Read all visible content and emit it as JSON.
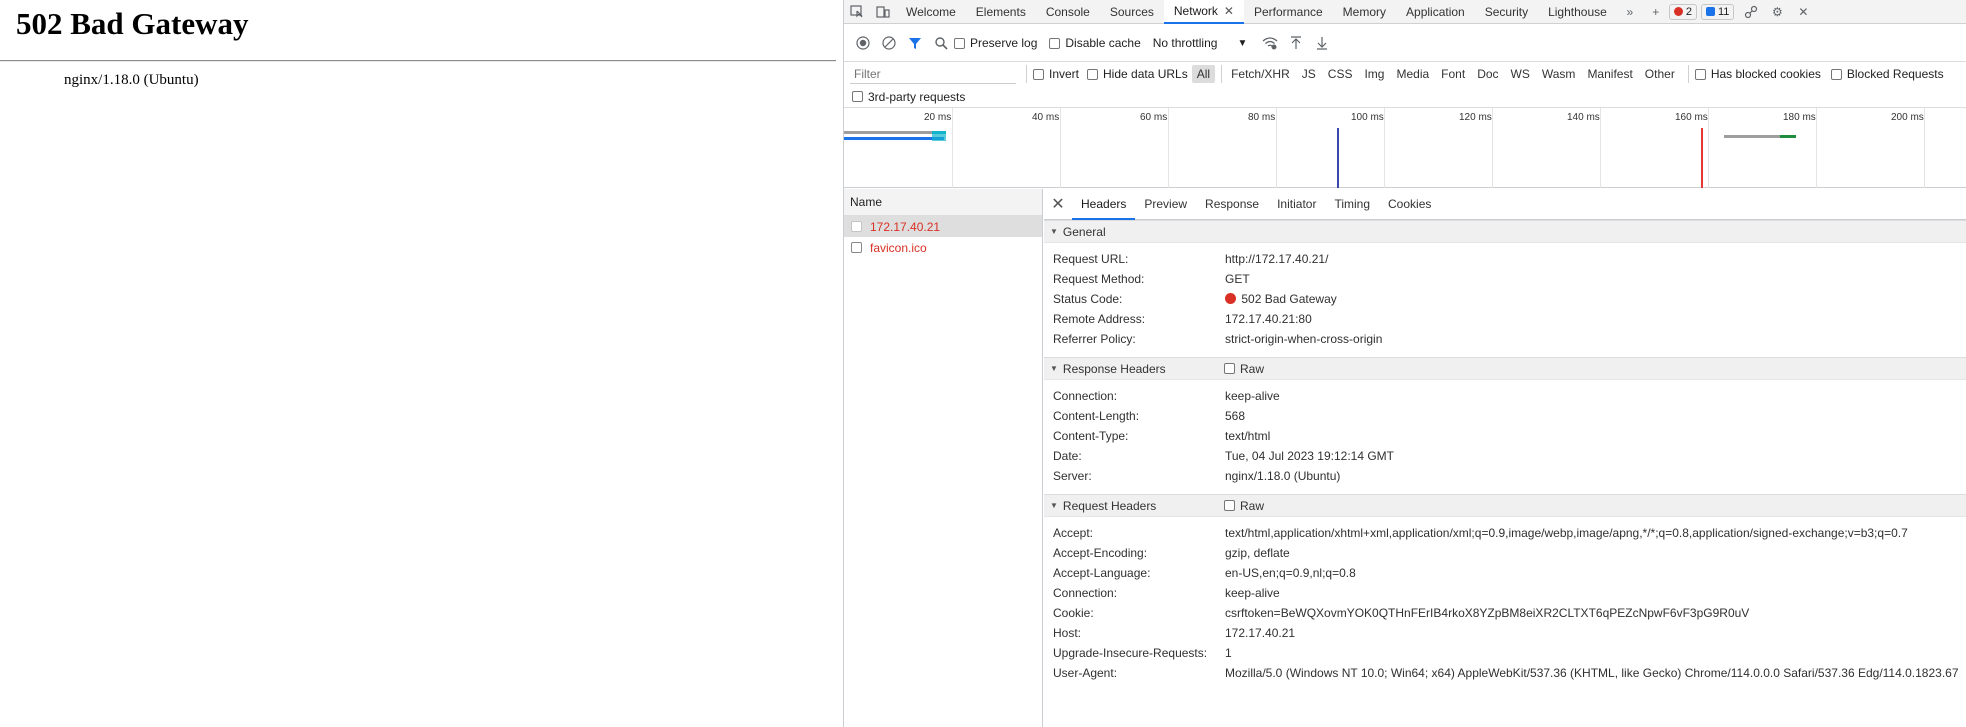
{
  "page": {
    "title": "502 Bad Gateway",
    "server": "nginx/1.18.0 (Ubuntu)"
  },
  "devtools": {
    "tabs": [
      "Welcome",
      "Elements",
      "Console",
      "Sources",
      "Network",
      "Performance",
      "Memory",
      "Application",
      "Security",
      "Lighthouse"
    ],
    "active_tab": "Network",
    "error_count": "2",
    "message_count": "11",
    "toolbar": {
      "preserve_log": "Preserve log",
      "disable_cache": "Disable cache",
      "throttling": "No throttling"
    },
    "filter": {
      "placeholder": "Filter",
      "invert": "Invert",
      "hide_data_urls": "Hide data URLs",
      "types": [
        "All",
        "Fetch/XHR",
        "JS",
        "CSS",
        "Img",
        "Media",
        "Font",
        "Doc",
        "WS",
        "Wasm",
        "Manifest",
        "Other"
      ],
      "has_blocked_cookies": "Has blocked cookies",
      "blocked_requests": "Blocked Requests",
      "third_party": "3rd-party requests"
    },
    "overview_ticks": [
      "20 ms",
      "40 ms",
      "60 ms",
      "80 ms",
      "100 ms",
      "120 ms",
      "140 ms",
      "160 ms",
      "180 ms",
      "200 ms"
    ],
    "request_list": {
      "header": "Name",
      "items": [
        "172.17.40.21",
        "favicon.ico"
      ]
    },
    "detail": {
      "tabs": [
        "Headers",
        "Preview",
        "Response",
        "Initiator",
        "Timing",
        "Cookies"
      ],
      "general": {
        "title": "General",
        "rows": [
          {
            "k": "Request URL:",
            "v": "http://172.17.40.21/"
          },
          {
            "k": "Request Method:",
            "v": "GET"
          },
          {
            "k": "Status Code:",
            "v": "502 Bad Gateway"
          },
          {
            "k": "Remote Address:",
            "v": "172.17.40.21:80"
          },
          {
            "k": "Referrer Policy:",
            "v": "strict-origin-when-cross-origin"
          }
        ]
      },
      "response_headers": {
        "title": "Response Headers",
        "raw": "Raw",
        "rows": [
          {
            "k": "Connection:",
            "v": "keep-alive"
          },
          {
            "k": "Content-Length:",
            "v": "568"
          },
          {
            "k": "Content-Type:",
            "v": "text/html"
          },
          {
            "k": "Date:",
            "v": "Tue, 04 Jul 2023 19:12:14 GMT"
          },
          {
            "k": "Server:",
            "v": "nginx/1.18.0 (Ubuntu)"
          }
        ]
      },
      "request_headers": {
        "title": "Request Headers",
        "raw": "Raw",
        "rows": [
          {
            "k": "Accept:",
            "v": "text/html,application/xhtml+xml,application/xml;q=0.9,image/webp,image/apng,*/*;q=0.8,application/signed-exchange;v=b3;q=0.7"
          },
          {
            "k": "Accept-Encoding:",
            "v": "gzip, deflate"
          },
          {
            "k": "Accept-Language:",
            "v": "en-US,en;q=0.9,nl;q=0.8"
          },
          {
            "k": "Connection:",
            "v": "keep-alive"
          },
          {
            "k": "Cookie:",
            "v": "csrftoken=BeWQXovmYOK0QTHnFErIB4rkoX8YZpBM8eiXR2CLTXT6qPEZcNpwF6vF3pG9R0uV"
          },
          {
            "k": "Host:",
            "v": "172.17.40.21"
          },
          {
            "k": "Upgrade-Insecure-Requests:",
            "v": "1"
          },
          {
            "k": "User-Agent:",
            "v": "Mozilla/5.0 (Windows NT 10.0; Win64; x64) AppleWebKit/537.36 (KHTML, like Gecko) Chrome/114.0.0.0 Safari/537.36 Edg/114.0.1823.67"
          }
        ]
      }
    }
  }
}
